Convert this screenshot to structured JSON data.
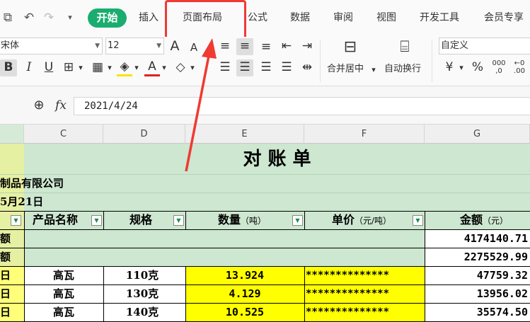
{
  "tabs": [
    "开始",
    "插入",
    "页面布局",
    "公式",
    "数据",
    "审阅",
    "视图",
    "开发工具",
    "会员专享"
  ],
  "ribbon": {
    "font_name": "宋体",
    "font_size": "12",
    "number_format": "自定义",
    "merge_label": "合并居中",
    "wrap_label": "自动换行",
    "bold": "B",
    "italic": "I",
    "underline": "U",
    "font_grow": "A",
    "font_shrink": "A",
    "font_color_glyph": "A",
    "currency_glyph": "¥",
    "percent_glyph": "%"
  },
  "formula_bar": {
    "fx_label": "fx",
    "value": "2021/4/24"
  },
  "columns": [
    "C",
    "D",
    "E",
    "F",
    "G"
  ],
  "sheet": {
    "title": "对 账 单",
    "company_partial": "制品有限公司",
    "date_partial": "5月21日",
    "headers": [
      {
        "main": "产品名称",
        "unit": ""
      },
      {
        "main": "规格",
        "unit": ""
      },
      {
        "main": "数量",
        "unit": "（吨）"
      },
      {
        "main": "单价",
        "unit": "（元/吨）"
      },
      {
        "main": "金额",
        "unit": "（元）"
      }
    ],
    "summary_rows": [
      {
        "label_partial": "额",
        "amount": "4174140.71"
      },
      {
        "label_partial": "额",
        "amount": "2275529.99"
      }
    ],
    "data_rows": [
      {
        "date_partial": "日",
        "name": "高瓦",
        "spec": "110克",
        "qty": "13.924",
        "price": "**************",
        "amount": "47759.32"
      },
      {
        "date_partial": "日",
        "name": "高瓦",
        "spec": "130克",
        "qty": "4.129",
        "price": "**************",
        "amount": "13956.02"
      },
      {
        "date_partial": "日",
        "name": "高瓦",
        "spec": "140克",
        "qty": "10.525",
        "price": "**************",
        "amount": "35574.50"
      }
    ]
  },
  "colors": {
    "accent_green": "#1aad6f",
    "sheet_green": "#cde7d0",
    "highlight_yellow": "#ffff00",
    "annotation_red": "#f03a32"
  }
}
